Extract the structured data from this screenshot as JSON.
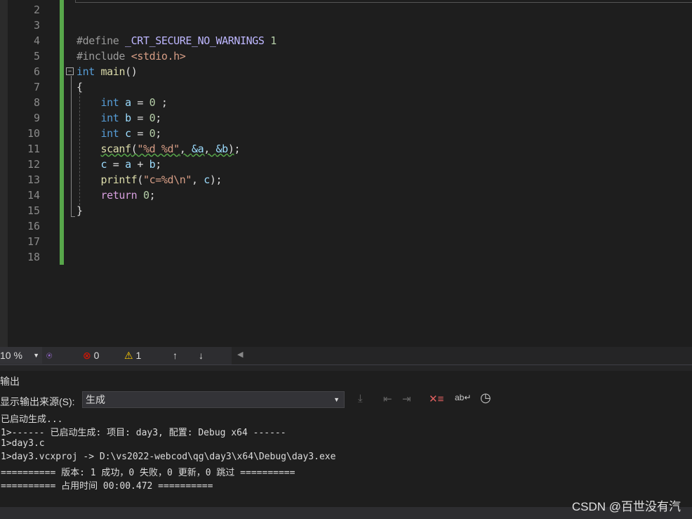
{
  "editor": {
    "line_numbers": [
      "2",
      "3",
      "4",
      "5",
      "6",
      "7",
      "8",
      "9",
      "10",
      "11",
      "12",
      "13",
      "14",
      "15",
      "16",
      "17",
      "18"
    ],
    "lines": [
      [],
      [],
      [
        [
          "#define ",
          "pp"
        ],
        [
          "_CRT_SECURE_NO_WARNINGS",
          "mac"
        ],
        [
          " 1",
          "num"
        ]
      ],
      [
        [
          "#include ",
          "pp"
        ],
        [
          "<stdio.h>",
          "str"
        ]
      ],
      [
        [
          "int",
          "kw"
        ],
        [
          " ",
          "pl"
        ],
        [
          "main",
          "fn"
        ],
        [
          "()",
          "pl"
        ]
      ],
      [
        [
          "{",
          "pl"
        ]
      ],
      [
        [
          "    ",
          "pl"
        ],
        [
          "int",
          "kw"
        ],
        [
          " ",
          "pl"
        ],
        [
          "a",
          "var"
        ],
        [
          " = ",
          "pl"
        ],
        [
          "0",
          "num"
        ],
        [
          " ;",
          "pl"
        ]
      ],
      [
        [
          "    ",
          "pl"
        ],
        [
          "int",
          "kw"
        ],
        [
          " ",
          "pl"
        ],
        [
          "b",
          "var"
        ],
        [
          " = ",
          "pl"
        ],
        [
          "0",
          "num"
        ],
        [
          ";",
          "pl"
        ]
      ],
      [
        [
          "    ",
          "pl"
        ],
        [
          "int",
          "kw"
        ],
        [
          " ",
          "pl"
        ],
        [
          "c",
          "var"
        ],
        [
          " = ",
          "pl"
        ],
        [
          "0",
          "num"
        ],
        [
          ";",
          "pl"
        ]
      ],
      [
        [
          "    ",
          "pl"
        ],
        [
          "scanf",
          "fn squig"
        ],
        [
          "(",
          "pl squig"
        ],
        [
          "\"%d %d\"",
          "str squig"
        ],
        [
          ", ",
          "pl squig"
        ],
        [
          "&a",
          "var squig"
        ],
        [
          ", ",
          "pl squig"
        ],
        [
          "&b",
          "var squig"
        ],
        [
          ")",
          "pl squig"
        ],
        [
          ";",
          "pl"
        ]
      ],
      [
        [
          "    ",
          "pl"
        ],
        [
          "c",
          "var"
        ],
        [
          " = ",
          "pl"
        ],
        [
          "a",
          "var"
        ],
        [
          " + ",
          "pl"
        ],
        [
          "b",
          "var"
        ],
        [
          ";",
          "pl"
        ]
      ],
      [
        [
          "    ",
          "pl"
        ],
        [
          "printf",
          "fn"
        ],
        [
          "(",
          "pl"
        ],
        [
          "\"c=%d\\n\"",
          "str"
        ],
        [
          ", ",
          "pl"
        ],
        [
          "c",
          "var"
        ],
        [
          ");",
          "pl"
        ]
      ],
      [
        [
          "    ",
          "pl"
        ],
        [
          "return",
          "ctl"
        ],
        [
          " ",
          "pl"
        ],
        [
          "0",
          "num"
        ],
        [
          ";",
          "pl"
        ]
      ],
      [
        [
          "}",
          "pl"
        ]
      ],
      [],
      [],
      []
    ]
  },
  "status": {
    "zoom": "10 %",
    "errors": "0",
    "warnings": "1"
  },
  "output": {
    "title": "输出",
    "source_label": "显示输出来源(S):",
    "source_value": "生成",
    "lines": [
      "已启动生成...",
      "1>------ 已启动生成: 项目: day3, 配置: Debug x64 ------",
      "1>day3.c",
      "1>day3.vcxproj -> D:\\vs2022-webcod\\qg\\day3\\x64\\Debug\\day3.exe",
      "========== 版本: 1 成功，0 失败，0 更新，0 跳过 ==========",
      "========== 占用时间 00:00.472 =========="
    ]
  },
  "watermark": "CSDN @百世没有汽"
}
